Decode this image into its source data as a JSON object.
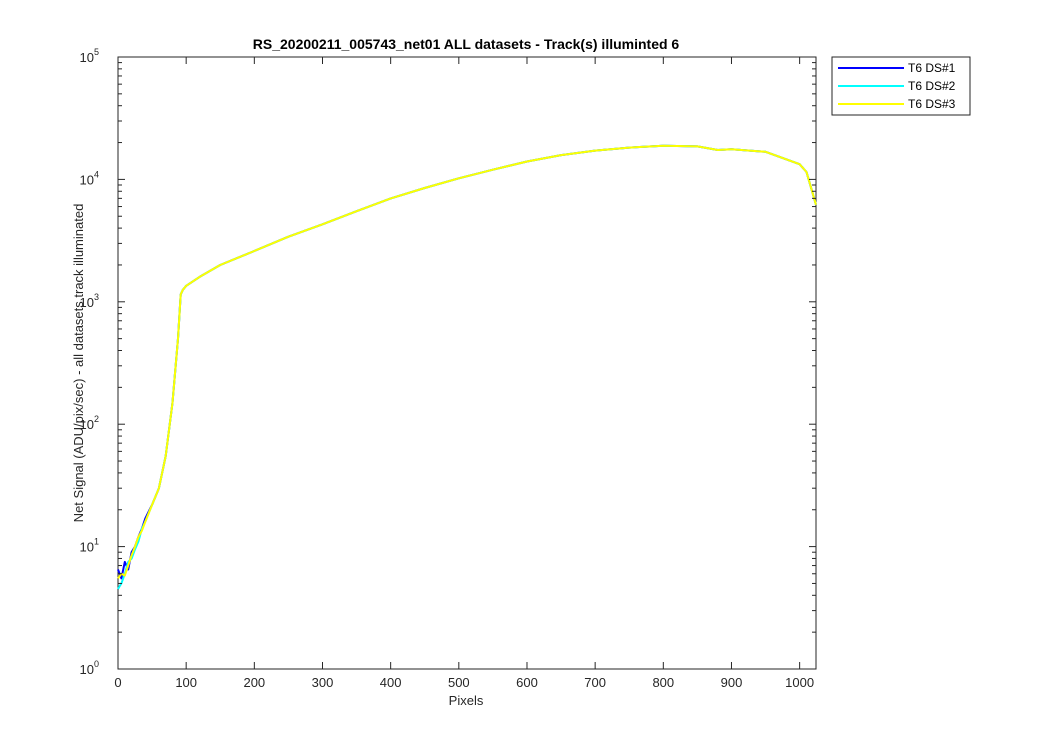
{
  "chart_data": {
    "type": "line",
    "title": "RS_20200211_005743_net01 ALL datasets - Track(s) illuminted 6",
    "xlabel": "Pixels",
    "ylabel": "Net Signal (ADU/pix/sec) - all datasets track illuminated",
    "xlim": [
      0,
      1024
    ],
    "ylim": [
      1,
      100000
    ],
    "yscale": "log",
    "grid": false,
    "legend_position": "outside-top-right",
    "x_ticks": [
      0,
      100,
      200,
      300,
      400,
      500,
      600,
      700,
      800,
      900,
      1000
    ],
    "y_ticks": [
      {
        "base": "10",
        "exp": "0",
        "value": 1
      },
      {
        "base": "10",
        "exp": "1",
        "value": 10
      },
      {
        "base": "10",
        "exp": "2",
        "value": 100
      },
      {
        "base": "10",
        "exp": "3",
        "value": 1000
      },
      {
        "base": "10",
        "exp": "4",
        "value": 10000
      },
      {
        "base": "10",
        "exp": "5",
        "value": 100000
      }
    ],
    "series": [
      {
        "name": "T6 DS#1",
        "color": "#0000ff",
        "x": [
          0,
          5,
          10,
          15,
          20,
          25,
          30,
          35,
          40,
          50,
          60,
          70,
          80,
          88,
          92,
          95,
          100,
          120,
          150,
          200,
          250,
          300,
          350,
          400,
          450,
          500,
          550,
          600,
          650,
          700,
          750,
          800,
          850,
          880,
          900,
          950,
          1000,
          1010,
          1024
        ],
        "y": [
          6.5,
          5.5,
          7.5,
          6.5,
          9,
          10,
          12,
          14,
          17,
          22,
          30,
          55,
          150,
          500,
          1150,
          1250,
          1350,
          1600,
          2000,
          2600,
          3400,
          4300,
          5500,
          7000,
          8500,
          10200,
          12000,
          14000,
          15800,
          17200,
          18200,
          18800,
          18600,
          17400,
          17600,
          16800,
          13300,
          11500,
          6200
        ]
      },
      {
        "name": "T6 DS#2",
        "color": "#00ffff",
        "x": [
          0,
          5,
          10,
          15,
          20,
          25,
          30,
          35,
          40,
          50,
          60,
          70,
          80,
          88,
          92,
          95,
          100,
          120,
          150,
          200,
          250,
          300,
          350,
          400,
          450,
          500,
          550,
          600,
          650,
          700,
          750,
          800,
          850,
          880,
          900,
          950,
          1000,
          1010,
          1024
        ],
        "y": [
          4.5,
          5,
          6,
          7.5,
          8,
          9.5,
          11,
          14,
          16,
          22,
          30,
          55,
          150,
          500,
          1150,
          1250,
          1350,
          1600,
          2000,
          2600,
          3400,
          4300,
          5500,
          7000,
          8500,
          10200,
          12000,
          14000,
          15800,
          17200,
          18200,
          18800,
          18600,
          17400,
          17600,
          16800,
          13300,
          11500,
          6200
        ]
      },
      {
        "name": "T6 DS#3",
        "color": "#ffff00",
        "x": [
          0,
          5,
          10,
          15,
          20,
          25,
          30,
          35,
          40,
          50,
          60,
          70,
          80,
          88,
          92,
          95,
          100,
          120,
          150,
          200,
          250,
          300,
          350,
          400,
          450,
          500,
          550,
          600,
          650,
          700,
          750,
          800,
          850,
          880,
          900,
          950,
          1000,
          1010,
          1024
        ],
        "y": [
          5.5,
          6,
          5.8,
          7,
          8.5,
          10,
          12,
          13.5,
          16,
          22,
          30,
          55,
          150,
          500,
          1150,
          1250,
          1350,
          1600,
          2000,
          2600,
          3400,
          4300,
          5500,
          7000,
          8500,
          10200,
          12000,
          14000,
          15800,
          17200,
          18200,
          18800,
          18600,
          17400,
          17600,
          16800,
          13300,
          11500,
          6200
        ]
      }
    ]
  }
}
